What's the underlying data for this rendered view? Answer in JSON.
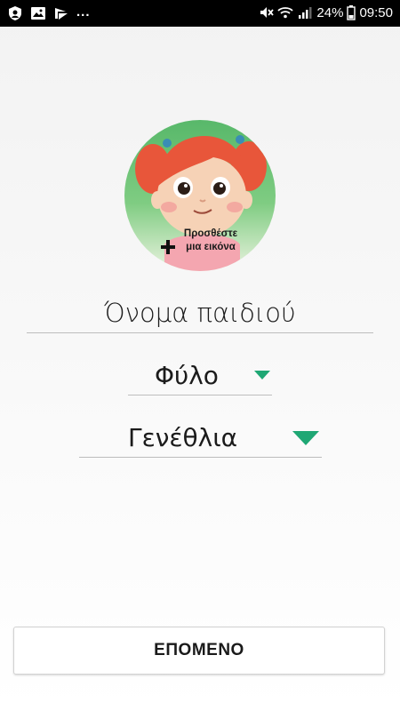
{
  "status_bar": {
    "left_icons": [
      "shield-icon",
      "image-icon",
      "play-store-icon"
    ],
    "more": "...",
    "right_icons": [
      "mute-icon",
      "wifi-icon",
      "signal-icon"
    ],
    "battery_percent": "24%",
    "battery_icon": "battery-icon",
    "time": "09:50"
  },
  "avatar": {
    "caption_line1": "Προσθέστε",
    "caption_line2": "μια εικόνα",
    "icon": "plus-icon"
  },
  "form": {
    "name_placeholder": "Όνομα παιδιού",
    "name_value": "",
    "gender_label": "Φύλο",
    "birthday_label": "Γενέθλια"
  },
  "actions": {
    "next_label": "ΕΠΟΜΕΝΟ"
  },
  "colors": {
    "accent": "#1fa774",
    "status_bar": "#000000",
    "avatar_bg": "#5fbf6f"
  }
}
